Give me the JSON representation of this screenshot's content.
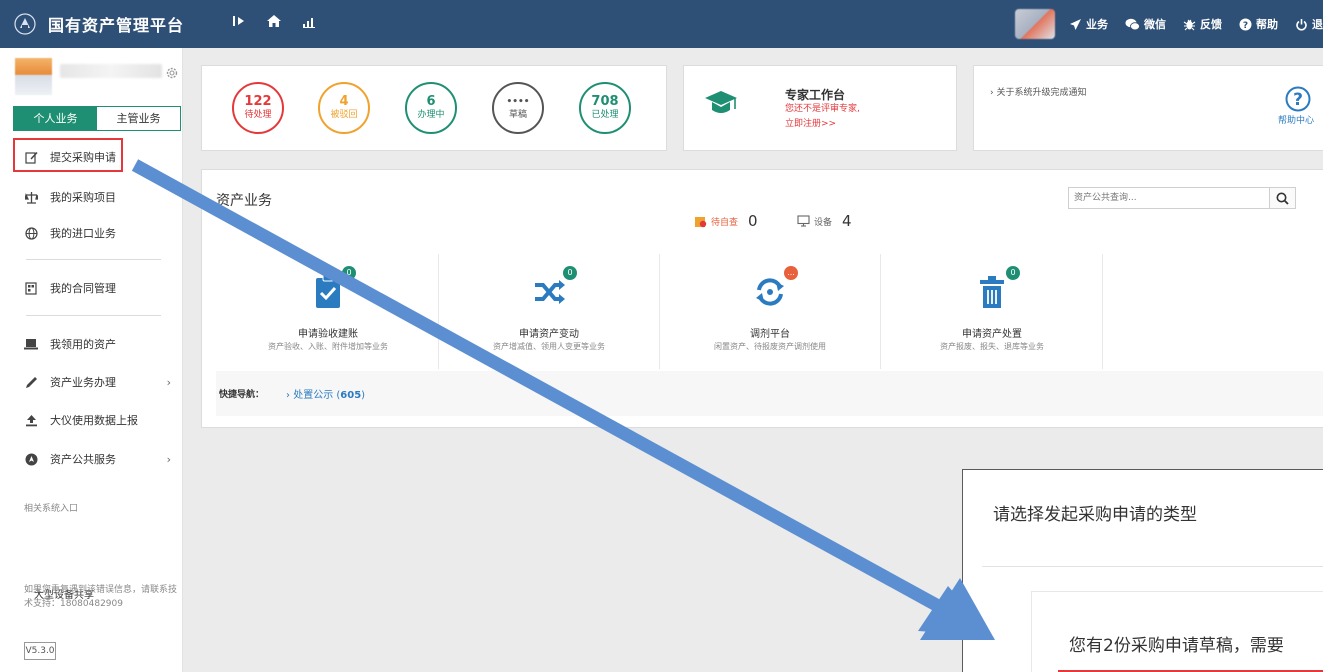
{
  "app": {
    "title": "国有资产管理平台",
    "brand_color": "#2f5076",
    "accent_color": "#1f8f73"
  },
  "topbar": {
    "nav_icons": [
      "sidebar-toggle-icon",
      "home-icon",
      "chart-icon"
    ],
    "links": [
      {
        "icon": "send-icon",
        "label": "业务"
      },
      {
        "icon": "wechat-icon",
        "label": "微信"
      },
      {
        "icon": "bug-icon",
        "label": "反馈"
      },
      {
        "icon": "help-icon",
        "label": "帮助"
      },
      {
        "icon": "power-icon",
        "label": "退"
      }
    ]
  },
  "sidebar": {
    "tabs": {
      "personal": "个人业务",
      "supervisor": "主管业务"
    },
    "items": [
      {
        "icon": "edit-icon",
        "label": "提交采购申请"
      },
      {
        "icon": "scale-icon",
        "label": "我的采购项目"
      },
      {
        "icon": "globe-icon",
        "label": "我的进口业务"
      },
      {
        "icon": "contract-icon",
        "label": "我的合同管理"
      },
      {
        "icon": "laptop-icon",
        "label": "我领用的资产"
      },
      {
        "icon": "pen-icon",
        "label": "资产业务办理"
      },
      {
        "icon": "upload-icon",
        "label": "大仪使用数据上报"
      },
      {
        "icon": "location-icon",
        "label": "资产公共服务"
      }
    ],
    "related_title": "相关系统入口",
    "share_label": "大型设备共享",
    "support_text_1": "如果您重复遇到该错误信息，请联系技",
    "support_text_2": "术支持：18080482909",
    "version": "V5.3.0"
  },
  "stats": [
    {
      "value": "122",
      "label": "待处理",
      "color": "#e5383b"
    },
    {
      "value": "4",
      "label": "被驳回",
      "color": "#f0a22e"
    },
    {
      "value": "6",
      "label": "办理中",
      "color": "#1f8f73"
    },
    {
      "value": "••••",
      "label": "草稿",
      "color": "#555555"
    },
    {
      "value": "708",
      "label": "已处理",
      "color": "#1f8f73"
    }
  ],
  "expert": {
    "title": "专家工作台",
    "note": "您还不是评审专家,",
    "link": "立即注册>>"
  },
  "notice": {
    "text": "› 关于系统升级完成通知",
    "help_label": "帮助中心"
  },
  "business": {
    "title": "资产业务",
    "search_placeholder": "资产公共查询...",
    "pending_check_label": "待自查",
    "pending_check_value": "0",
    "device_label": "设备",
    "device_value": "4",
    "items": [
      {
        "icon": "clipboard-check-icon",
        "name": "申请验收建账",
        "desc": "资产验收、入账、附件增加等业务",
        "badge": "0",
        "badge_color": "#1f8f73"
      },
      {
        "icon": "shuffle-icon",
        "name": "申请资产变动",
        "desc": "资产增减值、领用人变更等业务",
        "badge": "0",
        "badge_color": "#1f8f73"
      },
      {
        "icon": "sync-icon",
        "name": "调剂平台",
        "desc": "闲置资产、待报废资产调剂使用",
        "badge": "...",
        "badge_color": "#e8603c"
      },
      {
        "icon": "trash-icon",
        "name": "申请资产处置",
        "desc": "资产报废、报失、退库等业务",
        "badge": "0",
        "badge_color": "#1f8f73"
      }
    ],
    "quick_nav_label": "快捷导航：",
    "quick_link_text": "› 处置公示 (",
    "quick_link_count": "605",
    "quick_link_close": ")"
  },
  "dialog": {
    "title": "请选择发起采购申请的类型",
    "message": "您有2份采购申请草稿，需要"
  }
}
